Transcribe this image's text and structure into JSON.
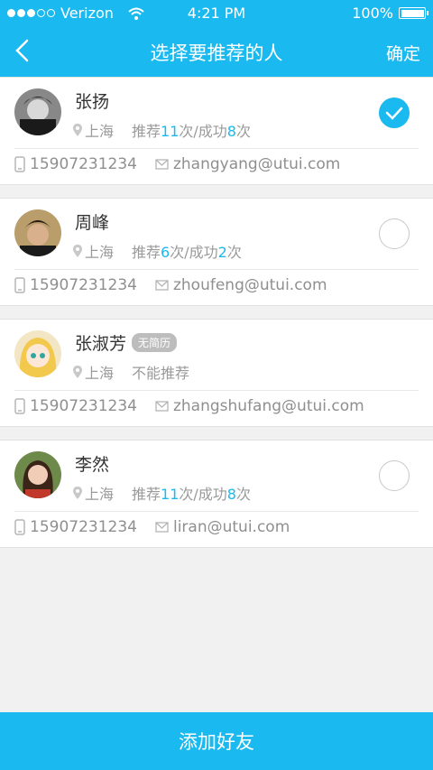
{
  "status_bar": {
    "carrier": "Verizon",
    "time": "4:21 PM",
    "battery": "100%"
  },
  "nav": {
    "title": "选择要推荐的人",
    "confirm_label": "确定"
  },
  "people": [
    {
      "name": "张扬",
      "tag": "",
      "location": "上海",
      "rec_prefix": "推荐",
      "rec_count": "11",
      "rec_mid": "次/成功",
      "success_count": "8",
      "rec_suffix": "次",
      "status_text": "",
      "phone": "15907231234",
      "email": "zhangyang@utui.com",
      "selected": true
    },
    {
      "name": "周峰",
      "tag": "",
      "location": "上海",
      "rec_prefix": "推荐",
      "rec_count": "6",
      "rec_mid": "次/成功",
      "success_count": "2",
      "rec_suffix": "次",
      "status_text": "",
      "phone": "15907231234",
      "email": "zhoufeng@utui.com",
      "selected": false
    },
    {
      "name": "张淑芳",
      "tag": "无简历",
      "location": "上海",
      "rec_prefix": "",
      "rec_count": "",
      "rec_mid": "",
      "success_count": "",
      "rec_suffix": "",
      "status_text": "不能推荐",
      "phone": "15907231234",
      "email": "zhangshufang@utui.com",
      "selected": null
    },
    {
      "name": "李然",
      "tag": "",
      "location": "上海",
      "rec_prefix": "推荐",
      "rec_count": "11",
      "rec_mid": "次/成功",
      "success_count": "8",
      "rec_suffix": "次",
      "status_text": "",
      "phone": "15907231234",
      "email": "liran@utui.com",
      "selected": false
    }
  ],
  "bottom_button_label": "添加好友",
  "colors": {
    "accent": "#1ab9ef",
    "background": "#f1f1f1",
    "text": "#333333",
    "muted": "#9a9a9a"
  }
}
